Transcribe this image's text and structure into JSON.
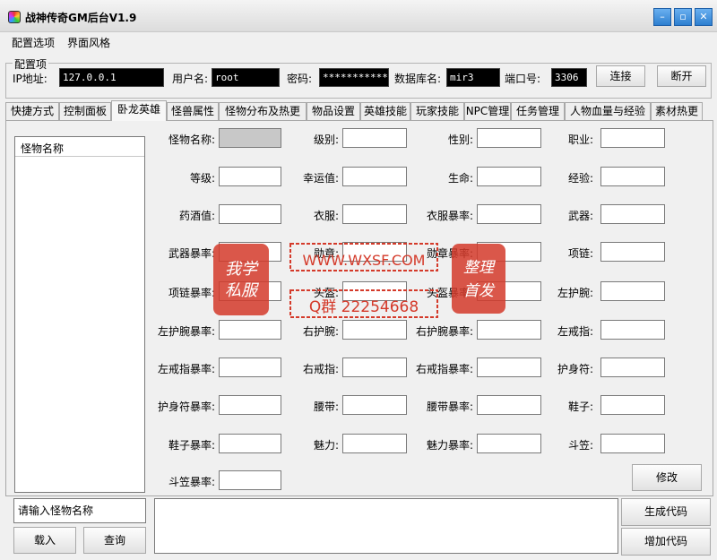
{
  "window": {
    "title": "战神传奇GM后台V1.9",
    "minimize": "–",
    "restore": "▫",
    "close": "✕"
  },
  "menu": [
    "配置选项",
    "界面风格"
  ],
  "config": {
    "legend": "配置项",
    "ip_label": "IP地址:",
    "ip_value": "127.0.0.1",
    "user_label": "用户名:",
    "user_value": "root",
    "pwd_label": "密码:",
    "pwd_value": "*************",
    "db_label": "数据库名:",
    "db_value": "mir3",
    "port_label": "端口号:",
    "port_value": "3306",
    "connect": "连接",
    "disconnect": "断开"
  },
  "tabs": [
    "快捷方式",
    "控制面板",
    "卧龙英雄",
    "怪兽属性",
    "怪物分布及热更",
    "物品设置",
    "英雄技能",
    "玩家技能",
    "NPC管理",
    "任务管理",
    "人物血量与经验",
    "素材热更"
  ],
  "active_tab": 2,
  "list": {
    "header": "怪物名称"
  },
  "fields": [
    "怪物名称:",
    "级别:",
    "性别:",
    "职业:",
    "等级:",
    "幸运值:",
    "生命:",
    "经验:",
    "药酒值:",
    "衣服:",
    "衣服暴率:",
    "武器:",
    "武器暴率:",
    "勋章:",
    "勋章暴率:",
    "项链:",
    "项链暴率:",
    "头盔:",
    "头盔暴率:",
    "左护腕:",
    "左护腕暴率:",
    "右护腕:",
    "右护腕暴率:",
    "左戒指:",
    "左戒指暴率:",
    "右戒指:",
    "右戒指暴率:",
    "护身符:",
    "护身符暴率:",
    "腰带:",
    "腰带暴率:",
    "鞋子:",
    "鞋子暴率:",
    "魅力:",
    "魅力暴率:",
    "斗笠:",
    "斗笠暴率:"
  ],
  "buttons": {
    "modify": "修改",
    "load": "载入",
    "query": "查询",
    "generate": "生成代码",
    "add": "增加代码"
  },
  "search": {
    "placeholder": "请输入怪物名称"
  },
  "watermark": {
    "left_seal": "我学私服",
    "url": "WWW.WXSF.COM",
    "qq": "Q群 22254668",
    "right_seal": "整理首发"
  }
}
